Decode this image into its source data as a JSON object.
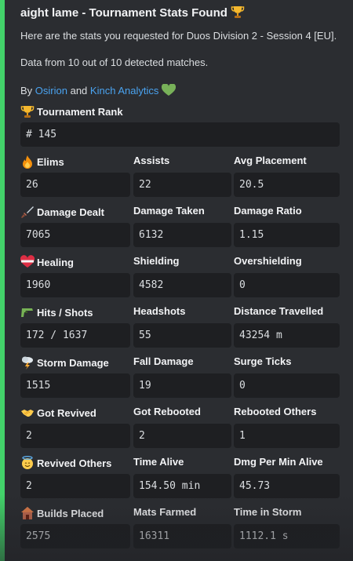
{
  "embed": {
    "title": "aight lame - Tournament Stats Found",
    "title_icon": "trophy-icon",
    "line1": "Here are the stats you requested for Duos Division 2 - Session 4 [EU].",
    "line2": "Data from 10 out of 10 detected matches.",
    "by_prefix": "By ",
    "author1": "Osirion",
    "and_text": " and ",
    "author2": "Kinch Analytics",
    "accent_color": "#43d26a",
    "link_color": "#4aa3f0"
  },
  "rank": {
    "label": "Tournament Rank",
    "icon": "trophy-icon",
    "value": "# 145"
  },
  "fields": [
    {
      "label": "Elims",
      "icon": "fire-icon",
      "value": "26"
    },
    {
      "label": "Assists",
      "value": "22"
    },
    {
      "label": "Avg Placement",
      "value": "20.5"
    },
    {
      "label": "Damage Dealt",
      "icon": "dagger-icon",
      "value": "7065"
    },
    {
      "label": "Damage Taken",
      "value": "6132"
    },
    {
      "label": "Damage Ratio",
      "value": "1.15"
    },
    {
      "label": "Healing",
      "icon": "mending-heart-icon",
      "value": "1960"
    },
    {
      "label": "Shielding",
      "value": "4582"
    },
    {
      "label": "Overshielding",
      "value": "0"
    },
    {
      "label": "Hits / Shots",
      "icon": "water-pistol-icon",
      "value": "172 / 1637"
    },
    {
      "label": "Headshots",
      "value": "55"
    },
    {
      "label": "Distance Travelled",
      "value": "43254 m"
    },
    {
      "label": "Storm Damage",
      "icon": "storm-cloud-icon",
      "value": "1515"
    },
    {
      "label": "Fall Damage",
      "value": "19"
    },
    {
      "label": "Surge Ticks",
      "value": "0"
    },
    {
      "label": "Got Revived",
      "icon": "handshake-icon",
      "value": "2"
    },
    {
      "label": "Got Rebooted",
      "value": "2"
    },
    {
      "label": "Rebooted Others",
      "value": "1"
    },
    {
      "label": "Revived Others",
      "icon": "halo-face-icon",
      "value": "2"
    },
    {
      "label": "Time Alive",
      "value": "154.50 min"
    },
    {
      "label": "Dmg Per Min Alive",
      "value": "45.73"
    },
    {
      "label": "Builds Placed",
      "icon": "house-icon",
      "value": "2575"
    },
    {
      "label": "Mats Farmed",
      "value": "16311"
    },
    {
      "label": "Time in Storm",
      "value": "1112.1 s"
    }
  ]
}
